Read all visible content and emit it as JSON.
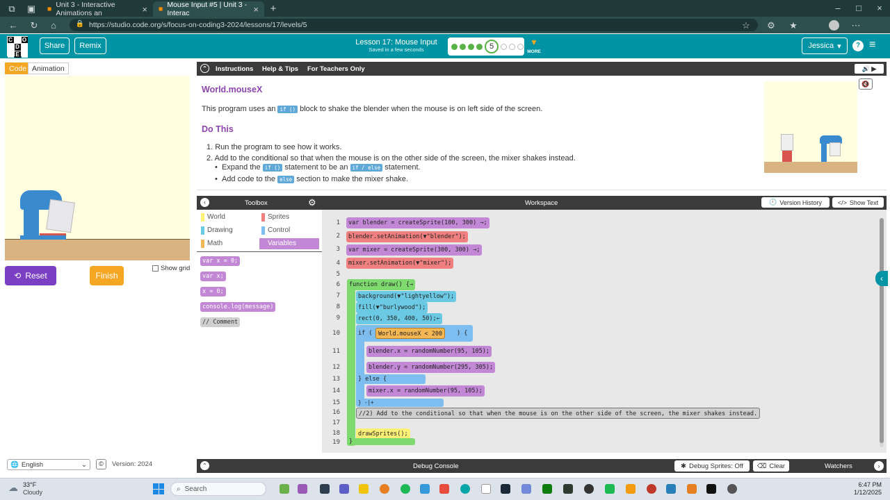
{
  "browser": {
    "tabs": [
      {
        "title": "Unit 3 - Interactive Animations an"
      },
      {
        "title": "Mouse Input #5 | Unit 3 - Interac"
      }
    ],
    "url": "https://studio.code.org/s/focus-on-coding3-2024/lessons/17/levels/5"
  },
  "header": {
    "logo_letters": [
      "C",
      "O",
      "D",
      "E"
    ],
    "share_label": "Share",
    "remix_label": "Remix",
    "lesson_title": "Lesson 17: Mouse Input",
    "saved_text": "Saved in a few seconds",
    "current_level": "5",
    "more_label": "MORE",
    "user_label": "Jessica"
  },
  "left": {
    "code_tab": "Code",
    "animation_tab": "Animation",
    "reset_label": "Reset",
    "finish_label": "Finish",
    "show_grid_label": "Show grid",
    "language": "English",
    "version": "Version: 2024"
  },
  "instructions": {
    "tabs": [
      "Instructions",
      "Help & Tips",
      "For Teachers Only"
    ],
    "heading": "World.mouseX",
    "intro_pre": "This program uses an",
    "intro_chip": "if ()",
    "intro_post": "block to shake the blender when the mouse is on left side of the screen.",
    "do_this": "Do This",
    "step1": "1. Run the program to see how it works.",
    "step2": "2. Add to the conditional so that when the mouse is on the other side of the screen, the mixer shakes instead.",
    "sub1_pre": "Expand the",
    "sub1_chip1": "if ()",
    "sub1_mid": "statement to be an",
    "sub1_chip2": "if / else",
    "sub1_post": "statement.",
    "sub2_pre": "Add code to the",
    "sub2_chip": "else",
    "sub2_post": "section to make the mixer shake."
  },
  "toolbox": {
    "title": "Toolbox",
    "categories": [
      {
        "label": "World",
        "color": "#fff176"
      },
      {
        "label": "Sprites",
        "color": "#f08080"
      },
      {
        "label": "Drawing",
        "color": "#6cc9e4"
      },
      {
        "label": "Control",
        "color": "#7dbdf0"
      },
      {
        "label": "Math",
        "color": "#f5b654"
      },
      {
        "label": "Variables",
        "color": "#c288d6"
      }
    ],
    "palette": [
      "var x = 0;",
      "var x;",
      "x = 0;",
      "console.log(message)",
      "// Comment"
    ]
  },
  "workspace": {
    "title": "Workspace",
    "version_history": "Version History",
    "show_text": "Show Text",
    "line_numbers": [
      "1",
      "2",
      "3",
      "4",
      "5",
      "6",
      "7",
      "8",
      "9",
      "10",
      "11",
      "12",
      "13",
      "14",
      "15",
      "16",
      "17",
      "18",
      "19"
    ],
    "lines": {
      "l1": "var blender = createSprite(100, 300) →;",
      "l2": "blender.setAnimation(▼\"blender\");",
      "l3": "var mixer = createSprite(300, 300) →;",
      "l4": "mixer.setAnimation(▼\"mixer\");",
      "l6": "function draw() {→",
      "l7": "background(▼\"lightyellow\");",
      "l8": "fill(▼\"burlywood\");",
      "l9": "rect(0, 350, 400, 50);←",
      "l10": "if (",
      "l10cond": "World.mouseX < 200",
      "l10end": ") {",
      "l11": "blender.x = randomNumber(95, 105);",
      "l12": "blender.y = randomNumber(295, 305);",
      "l13": "} else {",
      "l14": "mixer.x = randomNumber(95, 105);",
      "l15": "}  -|+",
      "l16": "//2) Add to the conditional so that when the mouse is on the other side of the screen, the mixer shakes instead.",
      "l18": "drawSprites();",
      "l19": "}"
    }
  },
  "debug": {
    "title": "Debug Console",
    "sprites_btn": "Debug Sprites: Off",
    "clear_btn": "Clear",
    "watchers": "Watchers"
  },
  "taskbar": {
    "weather_temp": "33°F",
    "weather_desc": "Cloudy",
    "search_placeholder": "Search",
    "time": "6:47 PM",
    "date": "1/12/2025"
  },
  "colors": {
    "teal": "#0094a4",
    "reset": "#7b3fc4",
    "finish": "#f5a623",
    "heading": "#8e44ad"
  }
}
